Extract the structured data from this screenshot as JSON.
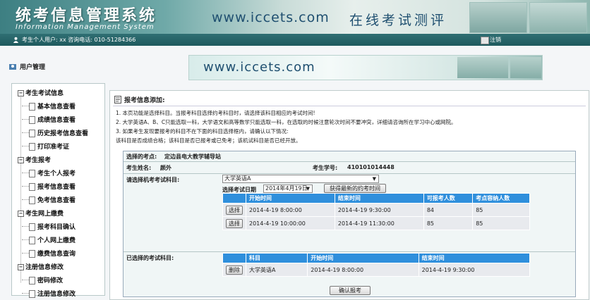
{
  "header": {
    "title": "统考信息管理系统",
    "subtitle": "Information Management System",
    "url": "www.iccets.com",
    "slogan": "在线考试测评"
  },
  "userbar": {
    "info": "考生个人用户: xx 咨询电话: 010-51284366",
    "logout": "注销"
  },
  "sidebar": {
    "heading": "用户管理",
    "groups": [
      {
        "label": "考生考试信息",
        "items": [
          "基本信息查看",
          "成绩信息查看",
          "历史报考信息查看",
          "打印准考证"
        ]
      },
      {
        "label": "考生报考",
        "items": [
          "考生个人报考",
          "报考信息查看",
          "免考信息查看"
        ]
      },
      {
        "label": "考生网上缴费",
        "items": [
          "报考科目确认",
          "个人网上缴费",
          "缴费信息查询"
        ]
      },
      {
        "label": "注册信息修改",
        "items": [
          "密码修改",
          "注册信息修改"
        ]
      }
    ]
  },
  "main": {
    "banner_url": "www.iccets.com",
    "section_title": "报考信息添加:",
    "notes": [
      "1. 本页功能是选择科目。当报考科目选择约考科目时，请选择该科目相应的考试时间!",
      "2. 大学英语A、B、C只能选取一科，大学语文和高等数学只能选取一科，在选取的时候注意轮次时间不要冲突，详细请咨询所在学习中心或网院。",
      "3. 如果考生发现要报考的科目不在下面的科目选择框内，请确认以下情况:",
      "   该科目是否成绩合格；该科目是否已报考或已免考；该机试科目是否已经开放。"
    ],
    "form": {
      "exam_site_label": "选择的考点:",
      "exam_site_value": "定边县电大教学辅导站",
      "name_label": "考生姓名:",
      "name_value": "颜外",
      "student_no_label": "考生学号:",
      "student_no_value": "410101014448",
      "subject_label": "请选择机考考试科目:",
      "subject_selected": "大学英语A",
      "date_label": "选择考试日期",
      "date_selected": "2014年4月19日",
      "fetch_button": "获得最新的约考时间",
      "slots_headers": [
        "",
        "开始时间",
        "结束时间",
        "可报考人数",
        "考点容纳人数"
      ],
      "slots": [
        {
          "action": "选择",
          "start": "2014-4-19 8:00:00",
          "end": "2014-4-19 9:30:00",
          "available": "84",
          "capacity": "85"
        },
        {
          "action": "选择",
          "start": "2014-4-19 10:00:00",
          "end": "2014-4-19 11:30:00",
          "available": "85",
          "capacity": "85"
        }
      ],
      "chosen_label": "已选择的考试科目:",
      "chosen_headers": [
        "",
        "科目",
        "开始时间",
        "结束时间"
      ],
      "chosen": [
        {
          "action": "删除",
          "subject": "大学英语A",
          "start": "2014-4-19 8:00:00",
          "end": "2014-4-19 9:30:00"
        }
      ],
      "confirm_button": "确认报考"
    }
  }
}
